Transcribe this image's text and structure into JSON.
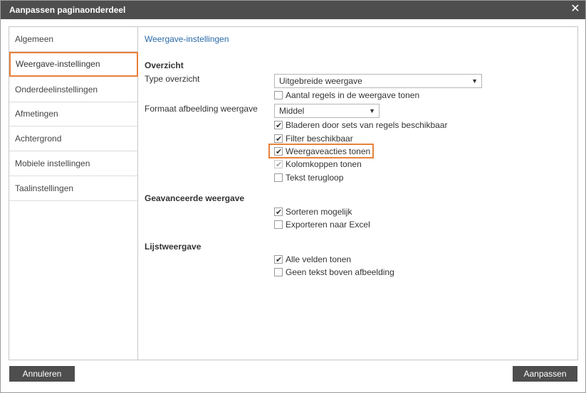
{
  "window": {
    "title": "Aanpassen paginaonderdeel"
  },
  "sidebar": {
    "items": [
      {
        "label": "Algemeen"
      },
      {
        "label": "Weergave-instellingen"
      },
      {
        "label": "Onderdeelinstellingen"
      },
      {
        "label": "Afmetingen"
      },
      {
        "label": "Achtergrond"
      },
      {
        "label": "Mobiele instellingen"
      },
      {
        "label": "Taalinstellingen"
      }
    ],
    "active_index": 1
  },
  "content": {
    "heading": "Weergave-instellingen",
    "overzicht": {
      "section_label": "Overzicht",
      "type_label": "Type overzicht",
      "type_value": "Uitgebreide weergave",
      "aantal_regels": {
        "label": "Aantal regels in de weergave tonen",
        "checked": false
      },
      "formaat_label": "Formaat afbeelding weergave",
      "formaat_value": "Middel",
      "bladeren": {
        "label": "Bladeren door sets van regels beschikbaar",
        "checked": true
      },
      "filter": {
        "label": "Filter beschikbaar",
        "checked": true
      },
      "weergaveacties": {
        "label": "Weergaveacties tonen",
        "checked": true
      },
      "kolomkoppen": {
        "label": "Kolomkoppen tonen",
        "checked": true,
        "disabled": true
      },
      "tekst_terugloop": {
        "label": "Tekst terugloop",
        "checked": false
      }
    },
    "geavanceerd": {
      "section_label": "Geavanceerde weergave",
      "sorteren": {
        "label": "Sorteren mogelijk",
        "checked": true
      },
      "exporteren": {
        "label": "Exporteren naar Excel",
        "checked": false
      }
    },
    "lijst": {
      "section_label": "Lijstweergave",
      "alle_velden": {
        "label": "Alle velden tonen",
        "checked": true
      },
      "geen_tekst": {
        "label": "Geen tekst boven afbeelding",
        "checked": false
      }
    }
  },
  "footer": {
    "cancel_label": "Annuleren",
    "apply_label": "Aanpassen"
  },
  "colors": {
    "titlebar": "#4e4e4e",
    "accent_highlight": "#e8803a",
    "heading_link": "#2a6aa8"
  }
}
